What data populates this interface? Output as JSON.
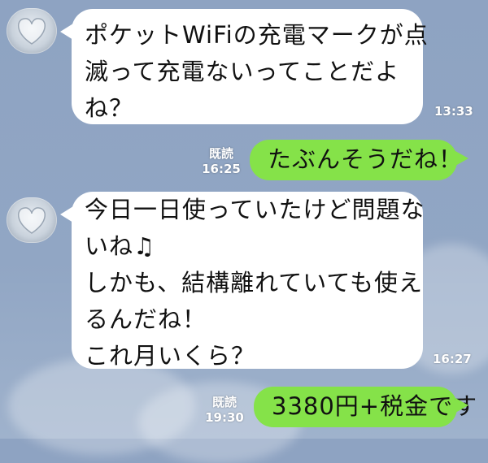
{
  "messages": [
    {
      "lines": [
        "ポケットWiFiの充電マークが点",
        "滅って充電ないってことだよ",
        "ね？"
      ],
      "time": "13:33"
    },
    {
      "text": "たぶんそうだね！",
      "read": "既読",
      "time": "16:25"
    },
    {
      "lines": [
        "今日一日使っていたけど問題な",
        "いね♫",
        "しかも、結構離れていても使え",
        "るんだね！",
        "これ月いくら？"
      ],
      "time": "16:27"
    },
    {
      "text": "3380円+税金です",
      "read": "既読",
      "time": "19:30"
    }
  ]
}
